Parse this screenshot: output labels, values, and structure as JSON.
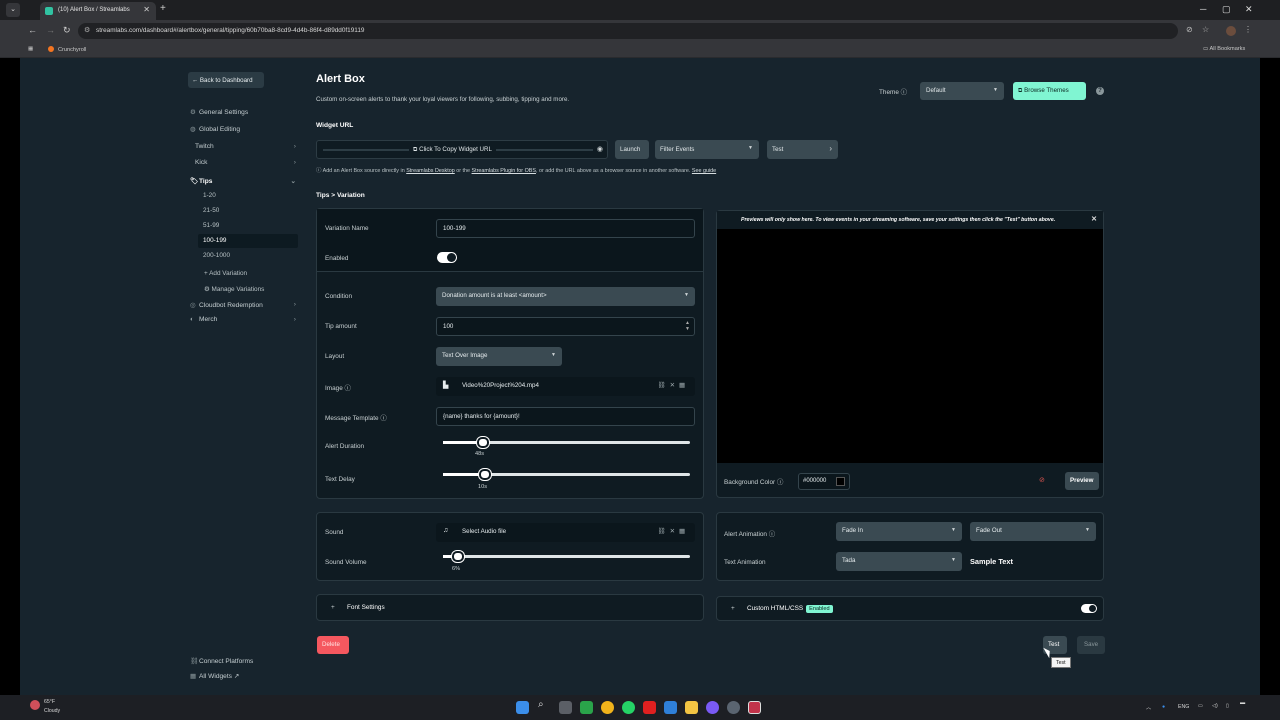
{
  "browser": {
    "tab_title": "(10) Alert Box / Streamlabs",
    "url": "streamlabs.com/dashboard#/alertbox/general/tipping/60b70ba8-8cd9-4d4b-86f4-d89dd0f19119",
    "bookmark": "Crunchyroll",
    "all_bookmarks": "All Bookmarks"
  },
  "sidebar": {
    "back": "Back to Dashboard",
    "general_settings": "General Settings",
    "global_editing": "Global Editing",
    "twitch": "Twitch",
    "kick": "Kick",
    "tips": "Tips",
    "tip_ranges": [
      "1-20",
      "21-50",
      "51-99",
      "100-199",
      "200-1000"
    ],
    "add_variation": "Add Variation",
    "manage_variations": "Manage Variations",
    "cloudbot": "Cloudbot Redemption",
    "merch": "Merch",
    "connect_platforms": "Connect Platforms",
    "all_widgets": "All Widgets"
  },
  "header": {
    "title": "Alert Box",
    "description": "Custom on-screen alerts to thank your loyal viewers for following, subbing, tipping and more.",
    "theme_label": "Theme",
    "theme_value": "Default",
    "browse_themes": "Browse Themes"
  },
  "widget_url": {
    "label": "Widget URL",
    "copy": "Click To Copy Widget URL",
    "launch": "Launch",
    "filter": "Filter Events",
    "test": "Test",
    "info_pre": "Add an Alert Box source directly in",
    "info_link1": "Streamlabs Desktop",
    "info_mid": "or the",
    "info_link2": "Streamlabs Plugin for OBS",
    "info_post": ", or add the URL above as a browser source in another software.",
    "info_link3": "See guide"
  },
  "breadcrumb": "Tips > Variation",
  "form": {
    "variation_name_label": "Variation Name",
    "variation_name_value": "100-199",
    "enabled_label": "Enabled",
    "condition_label": "Condition",
    "condition_value": "Donation amount is at least <amount>",
    "tip_amount_label": "Tip amount",
    "tip_amount_value": "100",
    "layout_label": "Layout",
    "layout_value": "Text Over Image",
    "image_label": "Image",
    "image_value": "Video%20Project%204.mp4",
    "message_label": "Message Template",
    "message_value": "{name} thanks for {amount}!",
    "alert_duration_label": "Alert Duration",
    "alert_duration_value": "48s",
    "alert_duration_level": 0.16,
    "text_delay_label": "Text Delay",
    "text_delay_value": "10s",
    "text_delay_level": 0.17
  },
  "preview": {
    "note": "Previews will only show here. To view events in your streaming software, save your settings then click the \"Test\" button above.",
    "bg_label": "Background Color",
    "bg_value": "#000000",
    "preview_btn": "Preview"
  },
  "sound": {
    "sound_label": "Sound",
    "sound_value": "Select Audio file",
    "volume_label": "Sound Volume",
    "volume_value": "6%",
    "volume_level": 0.06
  },
  "animation": {
    "alert_label": "Alert Animation",
    "alert_in": "Fade In",
    "alert_out": "Fade Out",
    "text_label": "Text Animation",
    "text_value": "Tada",
    "sample": "Sample Text"
  },
  "font_settings": "Font Settings",
  "custom_css": "Custom HTML/CSS",
  "custom_css_badge": "Enabled",
  "actions": {
    "delete": "Delete",
    "test": "Test",
    "save": "Save",
    "tooltip": "Test"
  },
  "taskbar": {
    "temp": "65°F",
    "weather": "Cloudy",
    "lang": "ENG"
  },
  "colors": {
    "accent": "#80f5d2",
    "page_bg": "#17242d",
    "panel_bg": "#0f1b22",
    "danger": "#f5585f"
  }
}
